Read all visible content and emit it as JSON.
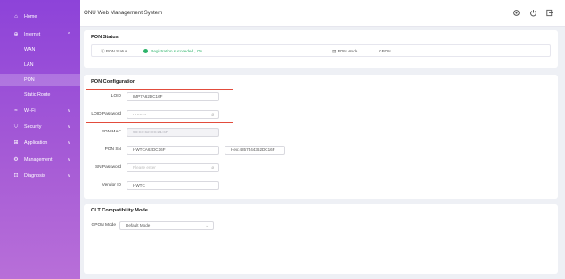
{
  "app_title": "ONU Web Management System",
  "sidebar": {
    "items": [
      {
        "label": "Home",
        "icon": "home-icon",
        "glyph": "⌂"
      },
      {
        "label": "Internet",
        "icon": "globe-icon",
        "glyph": "⊕",
        "chevron": "^"
      },
      {
        "label": "WAN"
      },
      {
        "label": "LAN"
      },
      {
        "label": "PON"
      },
      {
        "label": "Static Route"
      },
      {
        "label": "Wi-Fi",
        "icon": "wifi-icon",
        "glyph": "≈",
        "chevron": "v"
      },
      {
        "label": "Security",
        "icon": "shield-icon",
        "glyph": "⛉",
        "chevron": "v"
      },
      {
        "label": "Application",
        "icon": "grid-icon",
        "glyph": "⊞",
        "chevron": "v"
      },
      {
        "label": "Management",
        "icon": "gear-icon",
        "glyph": "⚙",
        "chevron": "v"
      },
      {
        "label": "Diagnosis",
        "icon": "toolbox-icon",
        "glyph": "⊡",
        "chevron": "v"
      }
    ]
  },
  "pon_status": {
    "title": "PON Status",
    "status_label": "PON Status",
    "status_value": "Registration succeeded , O5",
    "mode_label": "PON Mode",
    "mode_value": "GPON",
    "status_color": "#2db36a"
  },
  "pon_config": {
    "title": "PON Configuration",
    "loid_label": "LOID",
    "loid_value": "IMP7A62DC16F",
    "loid_password_label": "LOID Password",
    "loid_password_value": "··········",
    "pon_mac_label": "PON MAC",
    "pon_mac_value": "98:C7:62:DC:21:6F",
    "pon_sn_label": "PON SN",
    "pon_sn_value": "HWTCA62DC16F",
    "hex_value": "Hex:4857544362DC16F",
    "sn_password_label": "SN Password",
    "sn_password_placeholder": "Please enter",
    "vendor_id_label": "Vendor ID",
    "vendor_id_value": "HWTC"
  },
  "olt": {
    "title": "OLT Compatibility Mode",
    "gpon_mode_label": "GPON Mode",
    "gpon_mode_value": "Default Mode"
  }
}
